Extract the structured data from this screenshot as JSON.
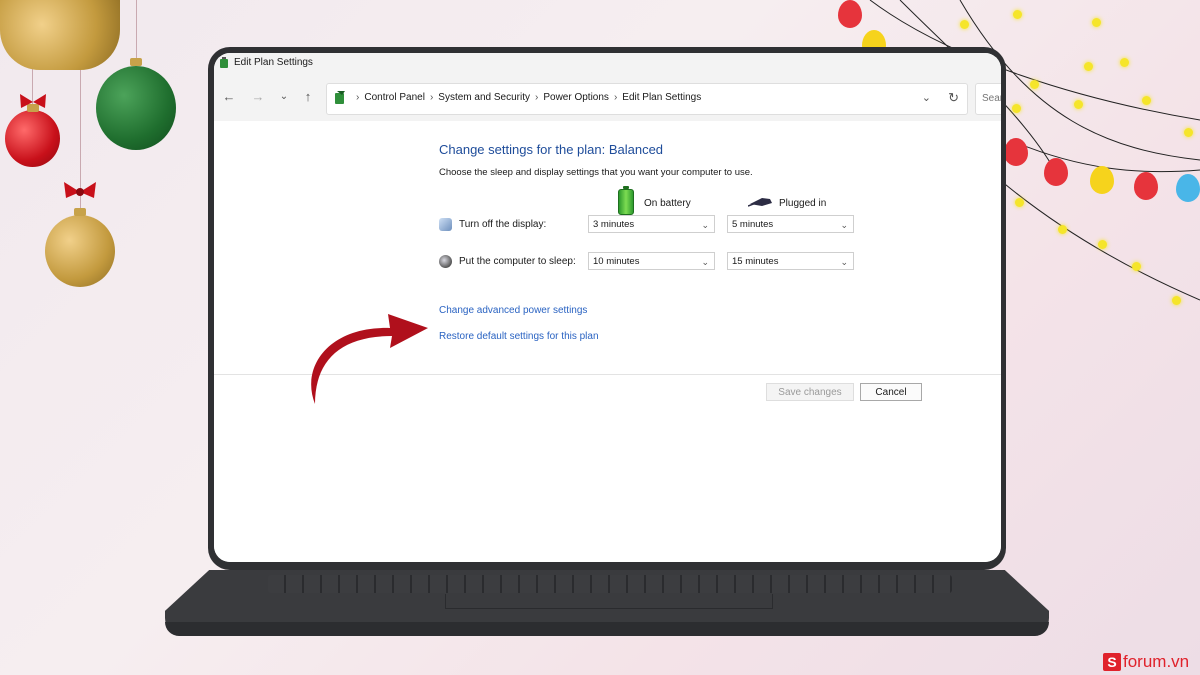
{
  "window": {
    "title": "Edit Plan Settings"
  },
  "nav": {
    "breadcrumbs": [
      "Control Panel",
      "System and Security",
      "Power Options",
      "Edit Plan Settings"
    ],
    "search_placeholder": "Sear"
  },
  "plan": {
    "heading": "Change settings for the plan: Balanced",
    "subheading": "Choose the sleep and display settings that you want your computer to use.",
    "col_battery": "On battery",
    "col_plugged": "Plugged in",
    "rows": [
      {
        "label": "Turn off the display:",
        "battery": "3 minutes",
        "plugged": "5 minutes"
      },
      {
        "label": "Put the computer to sleep:",
        "battery": "10 minutes",
        "plugged": "15 minutes"
      }
    ],
    "link_advanced": "Change advanced power settings",
    "link_restore": "Restore default settings for this plan",
    "save_label": "Save changes",
    "cancel_label": "Cancel"
  },
  "brand": {
    "logo_letter": "S",
    "text": "forum.vn"
  },
  "colors": {
    "heading": "#1e4c9a",
    "link": "#2a63c2",
    "arrow": "#b0101c",
    "brand": "#e0222b"
  }
}
